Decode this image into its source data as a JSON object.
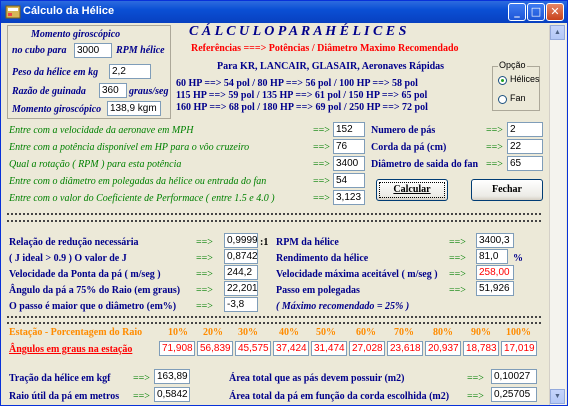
{
  "window": {
    "title": "Cálculo da Hélice"
  },
  "gyro": {
    "title": "Momento giroscópico",
    "hub_label": "no cubo para",
    "hub_value": "3000",
    "hub_unit": "RPM hélice",
    "weight_label": "Peso da hélice em kg",
    "weight_value": "2,2",
    "yaw_label": "Razão de guinada",
    "yaw_value": "360",
    "yaw_unit": "graus/seg",
    "moment_label": "Momento giroscópico",
    "moment_value": "138,9 kgm"
  },
  "header": {
    "title": "C Á L C U L O     P A R A     H É L I C E S",
    "ref": "Referências  ===> Potências / Diâmetro Maximo Recomendado",
    "aircraft": "Para KR, LANCAIR, GLASAIR, Aeronaves Rápidas",
    "rows": [
      "60  HP ==> 54 pol / 80  HP ==> 56 pol / 100 HP ==> 58 pol",
      "115 HP ==> 59 pol / 135 HP ==> 61 pol / 150 HP ==> 65 pol",
      "160 HP ==> 68 pol / 180 HP ==> 69 pol / 250 HP ==> 72 pol"
    ]
  },
  "option": {
    "title": "Opção",
    "helices": "Hélices",
    "fan": "Fan",
    "selected": "Hélices"
  },
  "inputs": {
    "arrow": "==>",
    "velocity_label": "Entre com a velocidade da aeronave em MPH",
    "velocity": "152",
    "power_label": "Entre com a potência disponível em HP para o vôo cruzeiro",
    "power": "76",
    "rpm_label": "Qual a rotação ( RPM ) para esta potência",
    "rpm": "3400",
    "diameter_label": "Entre com o diâmetro em polegadas da hélice ou entrada do fan",
    "diameter": "54",
    "coef_label": "Entre com o valor do Coeficiente de Performace ( entre 1.5 e 4.0 )",
    "coef": "3,123",
    "blades_label": "Numero de pás",
    "blades": "2",
    "chord_label": "Corda da pá (cm)",
    "chord": "22",
    "fan_label": "Diâmetro de saida do fan",
    "fan": "65"
  },
  "buttons": {
    "calc": "Calcular",
    "close": "Fechar"
  },
  "separator": "=====================================================================================",
  "results": {
    "reduction_label": "Relação de redução necessária",
    "reduction_value": "0,9999",
    "reduction_unit": ":1",
    "j_label": "( J ideal > 0.9 )      O valor de J",
    "j_value": "0,8742",
    "tip_label": "Velocidade da Ponta  da pá ( m/seg )",
    "tip_value": "244,2",
    "angle_label": "Ângulo da pá a 75% do Raio (em graus)",
    "angle_value": "22,201",
    "pitch_cmp_label": "O passo é maior que o diâmetro   (em%)",
    "pitch_cmp_value": "-3,8",
    "rpm_label": "RPM da hélice",
    "rpm_value": "3400,3",
    "eff_label": "Rendimento da hélice",
    "eff_value": "81,0",
    "eff_unit": "%",
    "maxvel_label": "Velocidade máxima aceitável ( m/seg )",
    "maxvel_value": "258,00",
    "pitch_label": "Passo em polegadas",
    "pitch_value": "51,926",
    "recommend": "( Máximo recomendado = 25% )"
  },
  "stations": {
    "header_label": "Estação - Porcentagem do Raio",
    "percentages": [
      "10%",
      "20%",
      "30%",
      "40%",
      "50%",
      "60%",
      "70%",
      "80%",
      "90%",
      "100%"
    ],
    "angles_label": "Ângulos em graus na estação",
    "angles": [
      "71,908",
      "56,839",
      "45,575",
      "37,424",
      "31,474",
      "27,028",
      "23,618",
      "20,937",
      "18,783",
      "17,019"
    ]
  },
  "bottom": {
    "traction_label": "Tração da hélice em kgf",
    "traction_value": "163,89",
    "radius_label": "Raio útil da pá em metros",
    "radius_value": "0,5842",
    "area_label": "Área total  que as pás devem possuir (m2)",
    "area_value": "0,10027",
    "area2_label": "Área total da pá em função da corda escolhida  (m2)",
    "area2_value": "0,25705"
  }
}
